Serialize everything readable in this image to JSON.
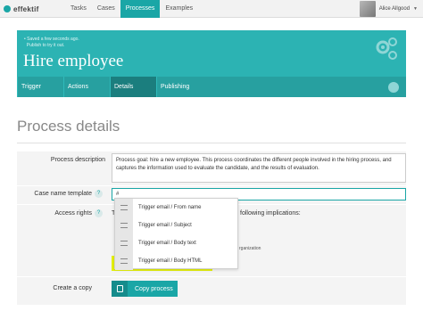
{
  "app": {
    "logo": "effektif"
  },
  "nav": {
    "items": [
      "Tasks",
      "Cases",
      "Processes",
      "Examples"
    ],
    "active": "Processes"
  },
  "user": {
    "name": "Alice Allgood"
  },
  "hero": {
    "status_line1": "Saved a few seconds ago.",
    "status_line2": "Publish to try it out.",
    "title": "Hire employee",
    "tabs": [
      "Trigger",
      "Actions",
      "Details",
      "Publishing"
    ],
    "active_tab": "Details"
  },
  "page": {
    "title": "Process details"
  },
  "form": {
    "description_label": "Process description",
    "description_value": "Process goal: hire a new employee. This process coordinates the different people involved in the hiring process, and captures the information used to evaluate the candidate, and the results of evaluation.",
    "case_name_label": "Case name template",
    "case_name_value": "#",
    "access_label": "Access rights",
    "access_prefix": "T",
    "access_suffix": "following implications:",
    "org_text": "rganization",
    "copy_label": "Create a copy",
    "copy_button": "Copy process"
  },
  "dropdown": {
    "items": [
      "Trigger email / From name",
      "Trigger email / Subject",
      "Trigger email / Body text",
      "Trigger email / Body HTML"
    ]
  },
  "colors": {
    "accent": "#1aa6a6",
    "hero": "#2cb3b3",
    "highlight": "#e6f20d"
  }
}
